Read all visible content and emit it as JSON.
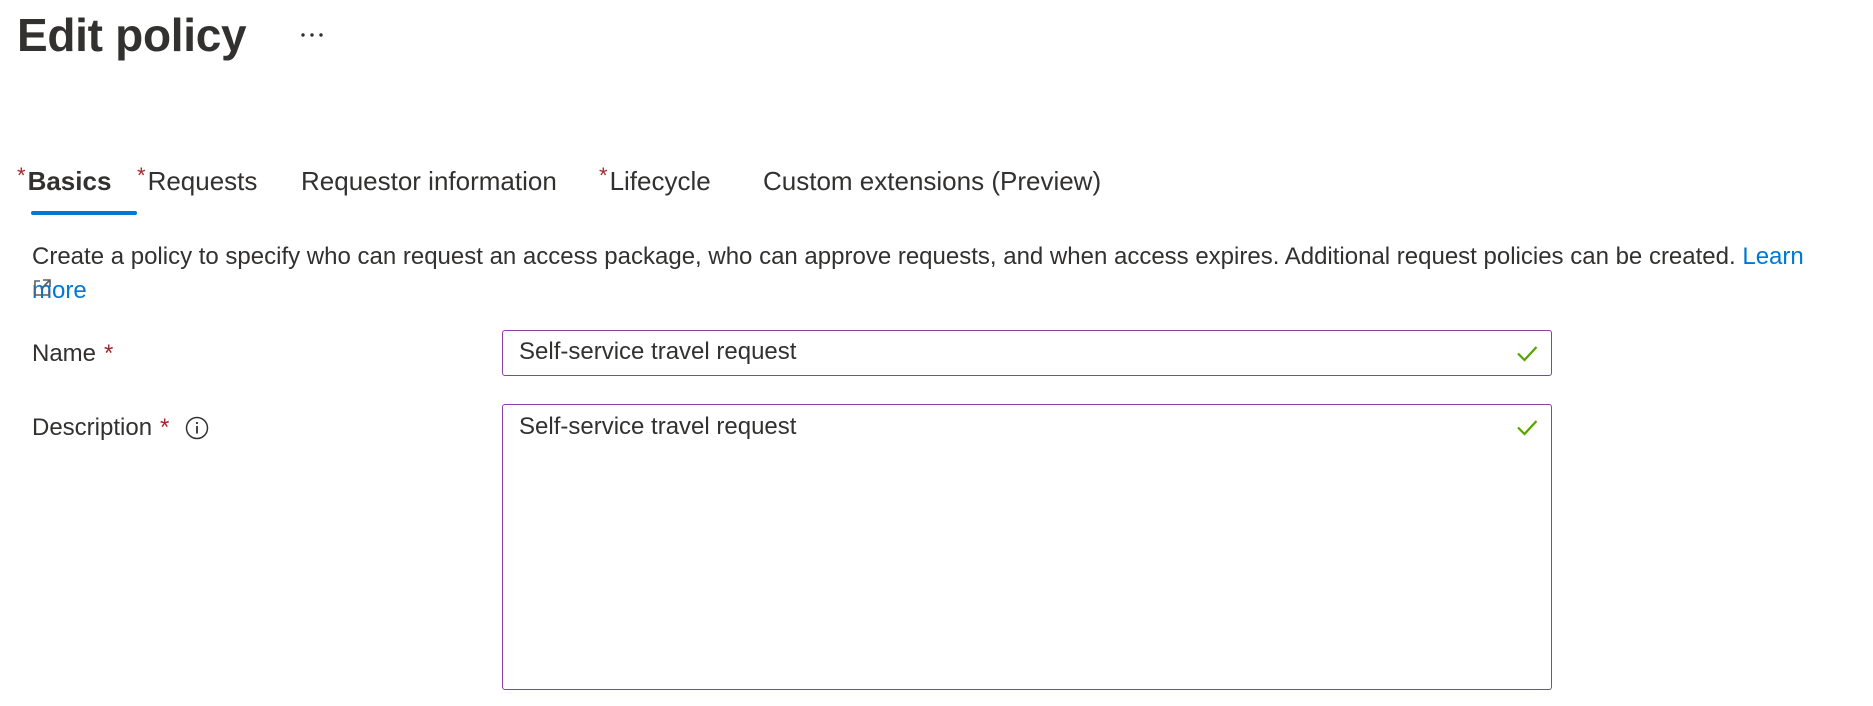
{
  "header": {
    "title": "Edit policy",
    "more_label": "..."
  },
  "tabs": [
    {
      "label": "Basics",
      "required": "*",
      "active": true
    },
    {
      "label": "Requests",
      "required": "*",
      "active": false
    },
    {
      "label": "Requestor information",
      "required": "",
      "active": false
    },
    {
      "label": "Lifecycle",
      "required": "*",
      "active": false
    },
    {
      "label": "Custom extensions (Preview)",
      "required": "",
      "active": false
    }
  ],
  "intro": {
    "text": "Create a policy to specify who can request an access package, who can approve requests, and when access expires. Additional request policies can be created.",
    "link_text": "Learn more",
    "link_icon": "external-link-icon"
  },
  "form": {
    "name": {
      "label": "Name",
      "required": "*",
      "value": "Self-service travel request",
      "status_icon": "check-icon"
    },
    "description": {
      "label": "Description",
      "required": "*",
      "info_icon": "info-icon",
      "value": "Self-service travel request",
      "status_icon": "check-icon"
    }
  },
  "colors": {
    "accent": "#0078d4",
    "required": "#a4262c",
    "field_border": "#8e3fa6",
    "valid": "#57a300",
    "text": "#323130"
  }
}
